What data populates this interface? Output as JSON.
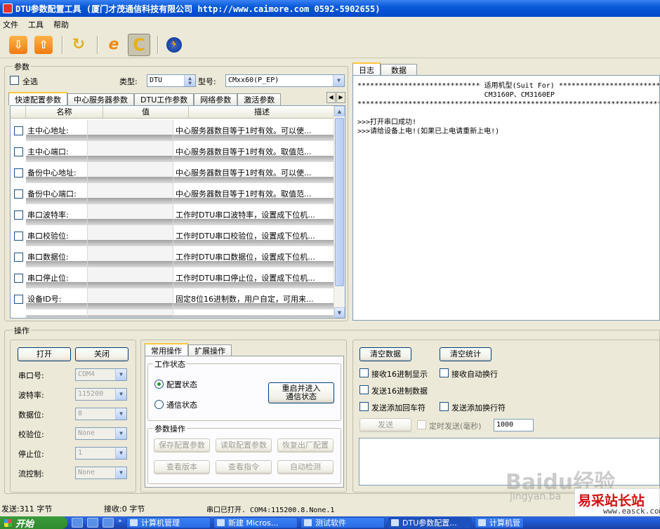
{
  "title": "DTU参数配置工具 (厦门才茂通信科技有限公司 http://www.caimore.com 0592-5902655)",
  "menu": [
    "文件",
    "工具",
    "帮助"
  ],
  "toolbar_icons": [
    "download-icon",
    "upload-icon",
    "refresh-icon",
    "ie-icon",
    "c-icon",
    "runner-icon"
  ],
  "params": {
    "group_label": "参数",
    "select_all": "全选",
    "type_label": "类型:",
    "type_value": "DTU",
    "model_label": "型号:",
    "model_value": "CMxx60(P_EP)",
    "tabs": [
      "快速配置参数",
      "中心服务器参数",
      "DTU工作参数",
      "网络参数",
      "激活参数"
    ],
    "columns": [
      "名称",
      "值",
      "描述"
    ],
    "rows": [
      {
        "name": "主中心地址:",
        "desc": "中心服务器数目等于1时有效。可以使..."
      },
      {
        "name": "主中心端口:",
        "desc": "中心服务器数目等于1时有效。取值范..."
      },
      {
        "name": "备份中心地址:",
        "desc": "中心服务器数目等于1时有效。可以使..."
      },
      {
        "name": "备份中心端口:",
        "desc": "中心服务器数目等于1时有效。取值范..."
      },
      {
        "name": "串口波特率:",
        "desc": "工作时DTU串口波特率，设置成下位机..."
      },
      {
        "name": "串口校验位:",
        "desc": "工作时DTU串口校验位，设置成下位机..."
      },
      {
        "name": "串口数据位:",
        "desc": "工作时DTU串口数据位，设置成下位机..."
      },
      {
        "name": "串口停止位:",
        "desc": "工作时DTU串口停止位，设置成下位机..."
      },
      {
        "name": "设备ID号:",
        "desc": "固定8位16进制数，用户自定，可用来..."
      }
    ]
  },
  "log_tabs": [
    "日志",
    "数据"
  ],
  "log_text": "***************************** 适用机型(Suit For) ***********************************\n                              CM3160P、CM3160EP\n***********************************************************************************\n\n>>>打开串口成功!\n>>>请给设备上电!(如果已上电请重新上电!)",
  "ops": {
    "group_label": "操作",
    "open": "打开",
    "close": "关闭",
    "serial_fields": [
      {
        "label": "串口号:",
        "value": "COM4"
      },
      {
        "label": "波特率:",
        "value": "115200"
      },
      {
        "label": "数据位:",
        "value": "8"
      },
      {
        "label": "校验位:",
        "value": "None"
      },
      {
        "label": "停止位:",
        "value": "1"
      },
      {
        "label": "流控制:",
        "value": "None"
      }
    ],
    "tabs": [
      "常用操作",
      "扩展操作"
    ],
    "work_state_label": "工作状态",
    "config_state": "配置状态",
    "comm_state": "通信状态",
    "restart_btn": "重启并进入\n通信状态",
    "param_ops_label": "参数操作",
    "btns": [
      "保存配置参数",
      "读取配置参数",
      "恢复出厂配置",
      "查看版本",
      "查看指令",
      "自动检测"
    ]
  },
  "data_ops": {
    "clear_data": "清空数据",
    "clear_stats": "清空统计",
    "recv_hex": "接收16进制显示",
    "recv_autowrap": "接收自动换行",
    "send_hex": "发送16进制数据",
    "send_cr": "发送添加回车符",
    "send_lf": "发送添加换行符",
    "send": "发送",
    "timed_send": "定时发送(毫秒)",
    "interval": "1000"
  },
  "status": {
    "sent": "发送:311 字节",
    "recv": "接收:0 字节",
    "port": "串口已打开. COM4:115200.8.None.1"
  },
  "taskbar": {
    "start": "开始",
    "tasks": [
      "计算机管理",
      "新建 Micros...",
      "测试软件",
      "DTU参数配置...",
      "计算机管"
    ]
  },
  "watermark": {
    "baidu": "Baidu经验",
    "jingyan": "jingyan.ba",
    "site": "易采站长站",
    "site_url": "www.easck.com"
  }
}
